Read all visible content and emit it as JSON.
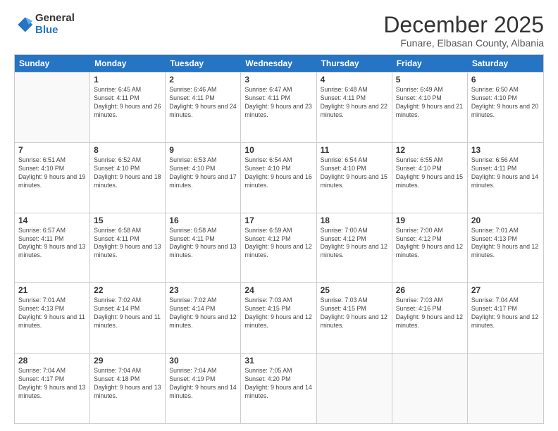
{
  "logo": {
    "general": "General",
    "blue": "Blue"
  },
  "title": "December 2025",
  "subtitle": "Funare, Elbasan County, Albania",
  "header_days": [
    "Sunday",
    "Monday",
    "Tuesday",
    "Wednesday",
    "Thursday",
    "Friday",
    "Saturday"
  ],
  "weeks": [
    [
      {
        "day": "",
        "info": ""
      },
      {
        "day": "1",
        "info": "Sunrise: 6:45 AM\nSunset: 4:11 PM\nDaylight: 9 hours\nand 26 minutes."
      },
      {
        "day": "2",
        "info": "Sunrise: 6:46 AM\nSunset: 4:11 PM\nDaylight: 9 hours\nand 24 minutes."
      },
      {
        "day": "3",
        "info": "Sunrise: 6:47 AM\nSunset: 4:11 PM\nDaylight: 9 hours\nand 23 minutes."
      },
      {
        "day": "4",
        "info": "Sunrise: 6:48 AM\nSunset: 4:11 PM\nDaylight: 9 hours\nand 22 minutes."
      },
      {
        "day": "5",
        "info": "Sunrise: 6:49 AM\nSunset: 4:10 PM\nDaylight: 9 hours\nand 21 minutes."
      },
      {
        "day": "6",
        "info": "Sunrise: 6:50 AM\nSunset: 4:10 PM\nDaylight: 9 hours\nand 20 minutes."
      }
    ],
    [
      {
        "day": "7",
        "info": "Sunrise: 6:51 AM\nSunset: 4:10 PM\nDaylight: 9 hours\nand 19 minutes."
      },
      {
        "day": "8",
        "info": "Sunrise: 6:52 AM\nSunset: 4:10 PM\nDaylight: 9 hours\nand 18 minutes."
      },
      {
        "day": "9",
        "info": "Sunrise: 6:53 AM\nSunset: 4:10 PM\nDaylight: 9 hours\nand 17 minutes."
      },
      {
        "day": "10",
        "info": "Sunrise: 6:54 AM\nSunset: 4:10 PM\nDaylight: 9 hours\nand 16 minutes."
      },
      {
        "day": "11",
        "info": "Sunrise: 6:54 AM\nSunset: 4:10 PM\nDaylight: 9 hours\nand 15 minutes."
      },
      {
        "day": "12",
        "info": "Sunrise: 6:55 AM\nSunset: 4:10 PM\nDaylight: 9 hours\nand 15 minutes."
      },
      {
        "day": "13",
        "info": "Sunrise: 6:56 AM\nSunset: 4:11 PM\nDaylight: 9 hours\nand 14 minutes."
      }
    ],
    [
      {
        "day": "14",
        "info": "Sunrise: 6:57 AM\nSunset: 4:11 PM\nDaylight: 9 hours\nand 13 minutes."
      },
      {
        "day": "15",
        "info": "Sunrise: 6:58 AM\nSunset: 4:11 PM\nDaylight: 9 hours\nand 13 minutes."
      },
      {
        "day": "16",
        "info": "Sunrise: 6:58 AM\nSunset: 4:11 PM\nDaylight: 9 hours\nand 13 minutes."
      },
      {
        "day": "17",
        "info": "Sunrise: 6:59 AM\nSunset: 4:12 PM\nDaylight: 9 hours\nand 12 minutes."
      },
      {
        "day": "18",
        "info": "Sunrise: 7:00 AM\nSunset: 4:12 PM\nDaylight: 9 hours\nand 12 minutes."
      },
      {
        "day": "19",
        "info": "Sunrise: 7:00 AM\nSunset: 4:12 PM\nDaylight: 9 hours\nand 12 minutes."
      },
      {
        "day": "20",
        "info": "Sunrise: 7:01 AM\nSunset: 4:13 PM\nDaylight: 9 hours\nand 12 minutes."
      }
    ],
    [
      {
        "day": "21",
        "info": "Sunrise: 7:01 AM\nSunset: 4:13 PM\nDaylight: 9 hours\nand 11 minutes."
      },
      {
        "day": "22",
        "info": "Sunrise: 7:02 AM\nSunset: 4:14 PM\nDaylight: 9 hours\nand 11 minutes."
      },
      {
        "day": "23",
        "info": "Sunrise: 7:02 AM\nSunset: 4:14 PM\nDaylight: 9 hours\nand 12 minutes."
      },
      {
        "day": "24",
        "info": "Sunrise: 7:03 AM\nSunset: 4:15 PM\nDaylight: 9 hours\nand 12 minutes."
      },
      {
        "day": "25",
        "info": "Sunrise: 7:03 AM\nSunset: 4:15 PM\nDaylight: 9 hours\nand 12 minutes."
      },
      {
        "day": "26",
        "info": "Sunrise: 7:03 AM\nSunset: 4:16 PM\nDaylight: 9 hours\nand 12 minutes."
      },
      {
        "day": "27",
        "info": "Sunrise: 7:04 AM\nSunset: 4:17 PM\nDaylight: 9 hours\nand 12 minutes."
      }
    ],
    [
      {
        "day": "28",
        "info": "Sunrise: 7:04 AM\nSunset: 4:17 PM\nDaylight: 9 hours\nand 13 minutes."
      },
      {
        "day": "29",
        "info": "Sunrise: 7:04 AM\nSunset: 4:18 PM\nDaylight: 9 hours\nand 13 minutes."
      },
      {
        "day": "30",
        "info": "Sunrise: 7:04 AM\nSunset: 4:19 PM\nDaylight: 9 hours\nand 14 minutes."
      },
      {
        "day": "31",
        "info": "Sunrise: 7:05 AM\nSunset: 4:20 PM\nDaylight: 9 hours\nand 14 minutes."
      },
      {
        "day": "",
        "info": ""
      },
      {
        "day": "",
        "info": ""
      },
      {
        "day": "",
        "info": ""
      }
    ]
  ]
}
